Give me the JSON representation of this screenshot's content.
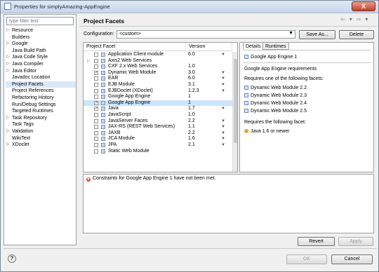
{
  "window": {
    "title": "Properties for simplyAmazing-AppEngine",
    "close_glyph": "X"
  },
  "filter": {
    "placeholder": "type filter text"
  },
  "tree": [
    {
      "label": "Resource",
      "twisty": "▷"
    },
    {
      "label": "Builders",
      "twisty": ""
    },
    {
      "label": "Google",
      "twisty": "▷"
    },
    {
      "label": "Java Build Path",
      "twisty": ""
    },
    {
      "label": "Java Code Style",
      "twisty": "▷"
    },
    {
      "label": "Java Compiler",
      "twisty": "▷"
    },
    {
      "label": "Java Editor",
      "twisty": "▷"
    },
    {
      "label": "Javadoc Location",
      "twisty": ""
    },
    {
      "label": "Project Facets",
      "twisty": "",
      "selected": true
    },
    {
      "label": "Project References",
      "twisty": ""
    },
    {
      "label": "Refactoring History",
      "twisty": ""
    },
    {
      "label": "Run/Debug Settings",
      "twisty": ""
    },
    {
      "label": "Targeted Runtimes",
      "twisty": ""
    },
    {
      "label": "Task Repository",
      "twisty": "▷"
    },
    {
      "label": "Task Tags",
      "twisty": ""
    },
    {
      "label": "Validation",
      "twisty": "▷"
    },
    {
      "label": "WikiText",
      "twisty": ""
    },
    {
      "label": "XDoclet",
      "twisty": "▷"
    }
  ],
  "page": {
    "title": "Project Facets",
    "nav": [
      "⇦",
      "▾",
      "⇨",
      "▾"
    ]
  },
  "configuration": {
    "label": "Configuration:",
    "value": "<custom>",
    "save_as": "Save As...",
    "delete": "Delete"
  },
  "facets": {
    "col_facet": "Project Facet",
    "col_version": "Version",
    "rows": [
      {
        "name": "Application Client module",
        "version": "6.0",
        "checked": false,
        "twisty": "",
        "dropdown": true
      },
      {
        "name": "Axis2 Web Services",
        "version": "",
        "checked": false,
        "twisty": "▷",
        "dropdown": false
      },
      {
        "name": "CXF 2.x Web Services",
        "version": "1.0",
        "checked": false,
        "twisty": "",
        "dropdown": false
      },
      {
        "name": "Dynamic Web Module",
        "version": "3.0",
        "checked": true,
        "twisty": "",
        "dropdown": true
      },
      {
        "name": "EAR",
        "version": "6.0",
        "checked": false,
        "twisty": "",
        "dropdown": true
      },
      {
        "name": "EJB Module",
        "version": "3.1",
        "checked": false,
        "twisty": "",
        "dropdown": true
      },
      {
        "name": "EJBDoclet (XDoclet)",
        "version": "1.2.3",
        "checked": false,
        "twisty": "",
        "dropdown": true
      },
      {
        "name": "Google App Engine",
        "version": "1",
        "checked": false,
        "twisty": "",
        "dropdown": false
      },
      {
        "name": "Google App Engine",
        "version": "1",
        "checked": true,
        "twisty": "",
        "dropdown": false,
        "selected": true
      },
      {
        "name": "Java",
        "version": "1.7",
        "checked": true,
        "twisty": "",
        "dropdown": true
      },
      {
        "name": "JavaScript",
        "version": "1.0",
        "checked": false,
        "twisty": "",
        "dropdown": false
      },
      {
        "name": "JavaServer Faces",
        "version": "2.2",
        "checked": false,
        "twisty": "",
        "dropdown": true
      },
      {
        "name": "JAX-RS (REST Web Services)",
        "version": "1.1",
        "checked": false,
        "twisty": "",
        "dropdown": true
      },
      {
        "name": "JAXB",
        "version": "2.2",
        "checked": false,
        "twisty": "",
        "dropdown": true
      },
      {
        "name": "JCA Module",
        "version": "1.6",
        "checked": false,
        "twisty": "",
        "dropdown": true
      },
      {
        "name": "JPA",
        "version": "2.1",
        "checked": false,
        "twisty": "",
        "dropdown": true
      },
      {
        "name": "Static Web Module",
        "version": "",
        "checked": false,
        "twisty": "",
        "dropdown": false
      }
    ]
  },
  "details": {
    "tab_details": "Details",
    "tab_runtimes": "Runtimes",
    "heading": "Google App Engine 1",
    "desc": "Google App Engine requirements",
    "requires_one": "Requires one of the following facets:",
    "one_of": [
      "Dynamic Web Module 2.2",
      "Dynamic Web Module 2.3",
      "Dynamic Web Module 2.4",
      "Dynamic Web Module 2.5"
    ],
    "requires_following": "Requires the following facet:",
    "following": "Java 1.6 or newer"
  },
  "message": {
    "error": "Constraints for Google App Engine 1 have not been met.",
    "error_glyph": "✖"
  },
  "buttons": {
    "revert": "Revert",
    "apply": "Apply",
    "ok": "OK",
    "cancel": "Cancel",
    "help": "?"
  },
  "icons": {
    "check": "✓"
  }
}
